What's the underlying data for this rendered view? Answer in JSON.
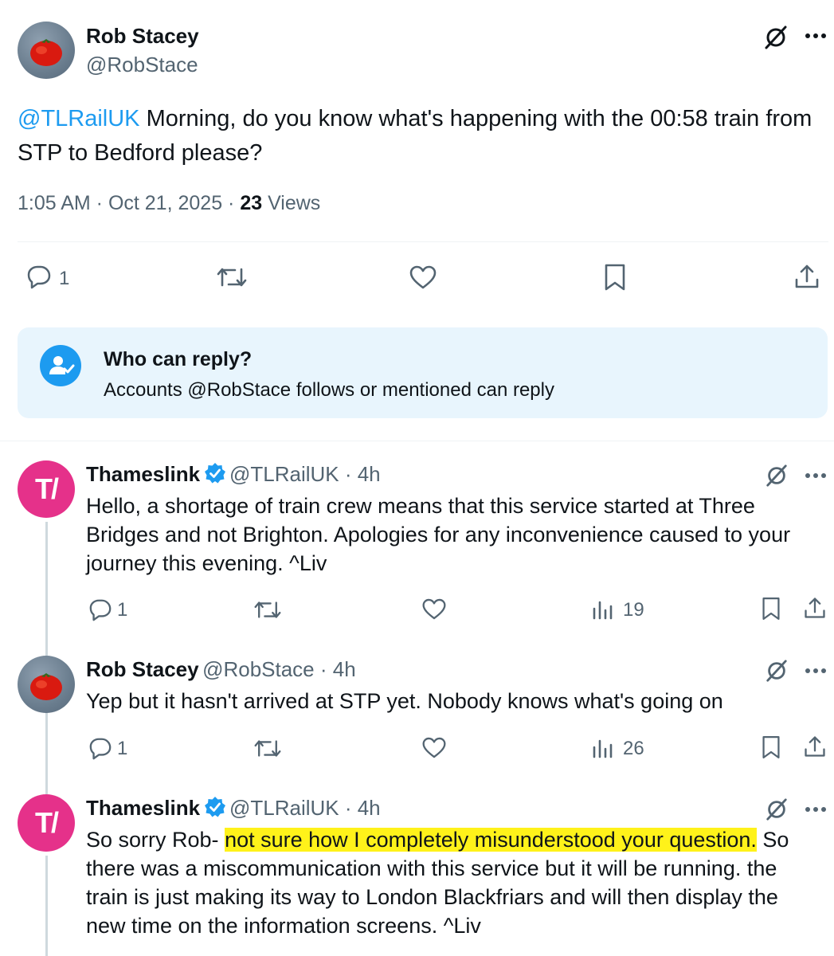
{
  "main_post": {
    "author_name": "Rob Stacey",
    "author_handle": "@RobStace",
    "mention": "@TLRailUK",
    "body_text": " Morning, do you know what's happening with the 00:58 train from STP to Bedford please?",
    "timestamp": "1:05 AM · Oct 21, 2025 · ",
    "views_count": "23",
    "views_label": " Views",
    "reply_count": "1"
  },
  "reply_restriction": {
    "title": "Who can reply?",
    "subtitle": "Accounts @RobStace follows or mentioned can reply"
  },
  "replies": [
    {
      "author_name": "Thameslink",
      "author_handle": "@TLRailUK · 4h",
      "body_text": "Hello, a shortage of train crew means that this service started at Three Bridges and not Brighton. Apologies for any inconvenience caused to your journey this evening. ^Liv",
      "reply_count": "1",
      "views_count": "19"
    },
    {
      "author_name": "Rob Stacey",
      "author_handle": "@RobStace · 4h",
      "body_text": "Yep but it hasn't arrived at STP yet. Nobody knows what's going on",
      "reply_count": "1",
      "views_count": "26"
    },
    {
      "author_name": "Thameslink",
      "author_handle": "@TLRailUK · 4h",
      "body_before": "So sorry Rob- ",
      "body_highlight": "not sure how I completely misunderstood your question.",
      "body_after": " So there was a miscommunication with this service but it will be running. the train is just making its way to London Blackfriars and will then display the new time on the information screens. ^Liv"
    }
  ],
  "avatars": {
    "thameslink_mark": "T/"
  },
  "colors": {
    "link": "#1d9bf0",
    "thameslink_pink": "#e5318a",
    "verified_blue": "#1d9bf0",
    "highlight": "#fff21a",
    "info_box_bg": "#e8f5fd"
  },
  "icons": [
    "grok-icon",
    "more-icon",
    "reply-icon",
    "repost-icon",
    "like-icon",
    "bookmark-icon",
    "share-icon",
    "views-icon",
    "verified-badge-icon",
    "user-check-icon"
  ]
}
